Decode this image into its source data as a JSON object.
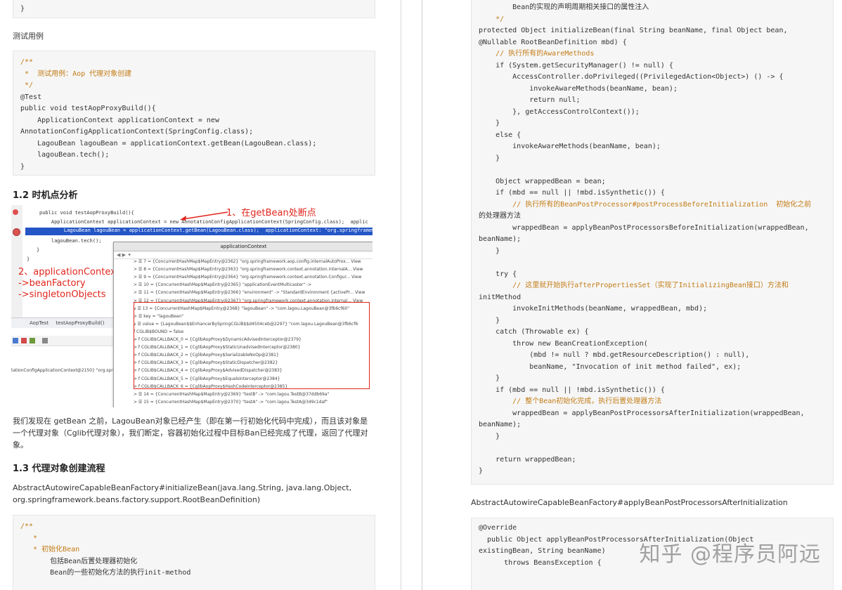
{
  "left": {
    "top_code_brace": "}",
    "test_label": "测试用例",
    "test_code": [
      "/**",
      " *  测试用例：Aop 代理对象创建",
      " */",
      "@Test",
      "public void testAopProxyBuild(){",
      "    ApplicationContext applicationContext = new",
      "AnnotationConfigApplicationContext(SpringConfig.class);",
      "    LagouBean lagouBean = applicationContext.getBean(LagouBean.class);",
      "    lagouBean.tech();",
      "}"
    ],
    "section_12": "1.2 时机点分析",
    "figure": {
      "ide_lines": [
        "public void testAopProxyBuild(){",
        "    ApplicationContext applicationContext = new AnnotationConfigApplicationContext(SpringConfig.class);  applic",
        "    LagouBean lagouBean = applicationContext.getBean(LagouBean.class);  applicationContext: \"org.springframework",
        "    lagouBean.tech();",
        "}",
        "}"
      ],
      "annotation_1": "1、在getBean处断点",
      "annotation_2": "2、applicationContext\n->beanFactory\n->singletonObjects",
      "bottom_tab_1": "AopTest",
      "bottom_tab_2": "testAopProxyBuild()",
      "bottom_trace": "tationConfigApplicationContext@2150} \"org.spr",
      "popup_title": "applicationContext",
      "popup_rows": [
        "> ☰ 7 = {ConcurrentHashMap$MapEntry@2362} \"org.springframework.aop.config.internalAutoProx... View",
        "> ☰ 8 = {ConcurrentHashMap$MapEntry@2363} \"org.springframework.context.annotation.internalA... View",
        "> ☰ 9 = {ConcurrentHashMap$MapEntry@2364} \"org.springframework.context.annotation.Configur... View",
        "> ☰ 10 = {ConcurrentHashMap$MapEntry@2365} \"applicationEventMulticaster\" ->",
        "> ☰ 11 = {ConcurrentHashMap$MapEntry@2366} \"environment\" -> \"StandardEnvironment {activePr... View",
        "> ☰ 12 = {ConcurrentHashMap$MapEntry@2367} \"org.springframework.context.annotation.internal... View",
        "v ☰ 13 = {ConcurrentHashMap$MapEntry@2368} \"lagouBean\" -> \"com.lagou.LagouBean@3fb6cf60\"",
        "   > ☰ key = \"lagouBean\"",
        "   v ☰ value = {LagouBean$$EnhancerBySpringCGLIB$$d4504ceb@2297} \"com.lagou.LagouBean@3fb6cf6",
        "        f CGLIB$BOUND = false",
        "      > f CGLIB$CALLBACK_0 = {CglibAopProxy$DynamicAdvisedInterceptor@2379}",
        "      > f CGLIB$CALLBACK_1 = {CglibAopProxy$StaticUnadvisedInterceptor@2380}",
        "      > f CGLIB$CALLBACK_2 = {CglibAopProxy$SerializableNoOp@2381}",
        "      > f CGLIB$CALLBACK_3 = {CglibAopProxy$StaticDispatcher@2382}",
        "      > f CGLIB$CALLBACK_4 = {CglibAopProxy$AdvisedDispatcher@2383}",
        "      > f CGLIB$CALLBACK_5 = {CglibAopProxy$EqualsInterceptor@2384}",
        "      > f CGLIB$CALLBACK_6 = {CglibAopProxy$HashCodeInterceptor@2385}",
        "> ☰ 14 = {ConcurrentHashMap$MapEntry@2369} \"testB\" -> \"com.lagou.TestB@37ddb69a\"",
        "> ☰ 15 = {ConcurrentHashMap$MapEntry@2370} \"testA\" -> \"com.lagou.TestA@349c1daf\""
      ]
    },
    "para_1": "我们发现在 getBean 之前，LagouBean对象已经产生（即在第一行初始化代码中完成），而且该对象是一个代理对象（Cglib代理对象），我们断定，容器初始化过程中目标Ban已经完成了代理，返回了代理对象。",
    "section_13": "1.3 代理对象创建流程",
    "method_sig": "AbstractAutowireCapableBeanFactory#initializeBean(java.lang.String, java.lang.Object, org.springframework.beans.factory.support.RootBeanDefinition)",
    "init_code": [
      "/**",
      "   *",
      "   * 初始化Bean",
      "       包括Bean后置处理器初始化",
      "       Bean的一些初始化方法的执行init-method"
    ]
  },
  "right": {
    "top_code": [
      "        Bean的实现的声明周期相关接口的属性注入",
      "    */",
      "protected Object initializeBean(final String beanName, final Object bean,",
      "@Nullable RootBeanDefinition mbd) {",
      "    // 执行所有的AwareMethods",
      "    if (System.getSecurityManager() != null) {",
      "        AccessController.doPrivileged((PrivilegedAction<Object>) () -> {",
      "            invokeAwareMethods(beanName, bean);",
      "            return null;",
      "        }, getAccessControlContext());",
      "    }",
      "    else {",
      "        invokeAwareMethods(beanName, bean);",
      "    }",
      "",
      "    Object wrappedBean = bean;",
      "    if (mbd == null || !mbd.isSynthetic()) {",
      "        // 执行所有的BeanPostProcessor#postProcessBeforeInitialization  初始化之前",
      "的处理器方法",
      "        wrappedBean = applyBeanPostProcessorsBeforeInitialization(wrappedBean,",
      "beanName);",
      "    }",
      "",
      "    try {",
      "        // 这里就开始执行afterPropertiesSet（实现了InitializingBean接口）方法和",
      "initMethod",
      "        invokeInitMethods(beanName, wrappedBean, mbd);",
      "    }",
      "    catch (Throwable ex) {",
      "        throw new BeanCreationException(",
      "            (mbd != null ? mbd.getResourceDescription() : null),",
      "            beanName, \"Invocation of init method failed\", ex);",
      "    }",
      "    if (mbd == null || !mbd.isSynthetic()) {",
      "        // 整个Bean初始化完成，执行后置处理器方法",
      "        wrappedBean = applyBeanPostProcessorsAfterInitialization(wrappedBean,",
      "beanName);",
      "    }",
      "",
      "    return wrappedBean;",
      "}"
    ],
    "method_sig_2": "AbstractAutowireCapableBeanFactory#applyBeanPostProcessorsAfterInitialization",
    "bottom_code": [
      "@Override",
      "  public Object applyBeanPostProcessorsAfterInitialization(Object",
      "existingBean, String beanName)",
      "      throws BeansException {"
    ],
    "watermark": "知乎 @程序员阿远"
  }
}
